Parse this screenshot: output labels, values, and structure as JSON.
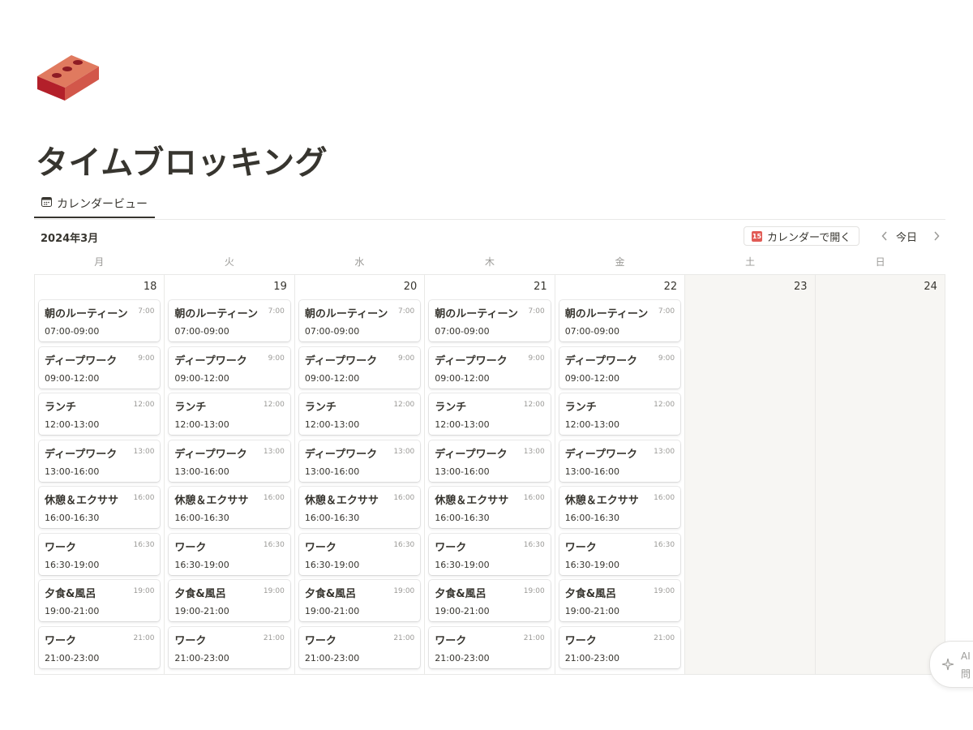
{
  "page": {
    "title": "タイムブロッキング",
    "icon": "brick-icon"
  },
  "view_tab": {
    "label": "カレンダービュー",
    "icon": "calendar-view-icon"
  },
  "toolbar": {
    "month": "2024年3月",
    "open_calendar_label": "カレンダーで開く",
    "open_calendar_icon_text": "15",
    "today_label": "今日"
  },
  "weekdays": [
    "月",
    "火",
    "水",
    "木",
    "金",
    "土",
    "日"
  ],
  "days": [
    {
      "num": "18",
      "weekend": false,
      "events": [
        {
          "title": "朝のルーティーン",
          "time": "7:00",
          "range": "07:00-09:00"
        },
        {
          "title": "ディープワーク",
          "time": "9:00",
          "range": "09:00-12:00"
        },
        {
          "title": "ランチ",
          "time": "12:00",
          "range": "12:00-13:00"
        },
        {
          "title": "ディープワーク",
          "time": "13:00",
          "range": "13:00-16:00"
        },
        {
          "title": "休憩＆エクササ",
          "time": "16:00",
          "range": "16:00-16:30"
        },
        {
          "title": "ワーク",
          "time": "16:30",
          "range": "16:30-19:00"
        },
        {
          "title": "夕食&風呂",
          "time": "19:00",
          "range": "19:00-21:00"
        },
        {
          "title": "ワーク",
          "time": "21:00",
          "range": "21:00-23:00"
        }
      ]
    },
    {
      "num": "19",
      "weekend": false,
      "events": [
        {
          "title": "朝のルーティーン",
          "time": "7:00",
          "range": "07:00-09:00"
        },
        {
          "title": "ディープワーク",
          "time": "9:00",
          "range": "09:00-12:00"
        },
        {
          "title": "ランチ",
          "time": "12:00",
          "range": "12:00-13:00"
        },
        {
          "title": "ディープワーク",
          "time": "13:00",
          "range": "13:00-16:00"
        },
        {
          "title": "休憩＆エクササ",
          "time": "16:00",
          "range": "16:00-16:30"
        },
        {
          "title": "ワーク",
          "time": "16:30",
          "range": "16:30-19:00"
        },
        {
          "title": "夕食&風呂",
          "time": "19:00",
          "range": "19:00-21:00"
        },
        {
          "title": "ワーク",
          "time": "21:00",
          "range": "21:00-23:00"
        }
      ]
    },
    {
      "num": "20",
      "weekend": false,
      "events": [
        {
          "title": "朝のルーティーン",
          "time": "7:00",
          "range": "07:00-09:00"
        },
        {
          "title": "ディープワーク",
          "time": "9:00",
          "range": "09:00-12:00"
        },
        {
          "title": "ランチ",
          "time": "12:00",
          "range": "12:00-13:00"
        },
        {
          "title": "ディープワーク",
          "time": "13:00",
          "range": "13:00-16:00"
        },
        {
          "title": "休憩＆エクササ",
          "time": "16:00",
          "range": "16:00-16:30"
        },
        {
          "title": "ワーク",
          "time": "16:30",
          "range": "16:30-19:00"
        },
        {
          "title": "夕食&風呂",
          "time": "19:00",
          "range": "19:00-21:00"
        },
        {
          "title": "ワーク",
          "time": "21:00",
          "range": "21:00-23:00"
        }
      ]
    },
    {
      "num": "21",
      "weekend": false,
      "events": [
        {
          "title": "朝のルーティーン",
          "time": "7:00",
          "range": "07:00-09:00"
        },
        {
          "title": "ディープワーク",
          "time": "9:00",
          "range": "09:00-12:00"
        },
        {
          "title": "ランチ",
          "time": "12:00",
          "range": "12:00-13:00"
        },
        {
          "title": "ディープワーク",
          "time": "13:00",
          "range": "13:00-16:00"
        },
        {
          "title": "休憩＆エクササ",
          "time": "16:00",
          "range": "16:00-16:30"
        },
        {
          "title": "ワーク",
          "time": "16:30",
          "range": "16:30-19:00"
        },
        {
          "title": "夕食&風呂",
          "time": "19:00",
          "range": "19:00-21:00"
        },
        {
          "title": "ワーク",
          "time": "21:00",
          "range": "21:00-23:00"
        }
      ]
    },
    {
      "num": "22",
      "weekend": false,
      "events": [
        {
          "title": "朝のルーティーン",
          "time": "7:00",
          "range": "07:00-09:00"
        },
        {
          "title": "ディープワーク",
          "time": "9:00",
          "range": "09:00-12:00"
        },
        {
          "title": "ランチ",
          "time": "12:00",
          "range": "12:00-13:00"
        },
        {
          "title": "ディープワーク",
          "time": "13:00",
          "range": "13:00-16:00"
        },
        {
          "title": "休憩＆エクササ",
          "time": "16:00",
          "range": "16:00-16:30"
        },
        {
          "title": "ワーク",
          "time": "16:30",
          "range": "16:30-19:00"
        },
        {
          "title": "夕食&風呂",
          "time": "19:00",
          "range": "19:00-21:00"
        },
        {
          "title": "ワーク",
          "time": "21:00",
          "range": "21:00-23:00"
        }
      ]
    },
    {
      "num": "23",
      "weekend": true,
      "events": []
    },
    {
      "num": "24",
      "weekend": true,
      "events": []
    }
  ],
  "ai_button": {
    "line1": "AI",
    "line2": "問",
    "icon": "sparkle-icon"
  },
  "colors": {
    "text": "#37352f",
    "muted": "#9b9a97",
    "weekend_bg": "#f7f6f3",
    "brick": "#c0392b"
  }
}
